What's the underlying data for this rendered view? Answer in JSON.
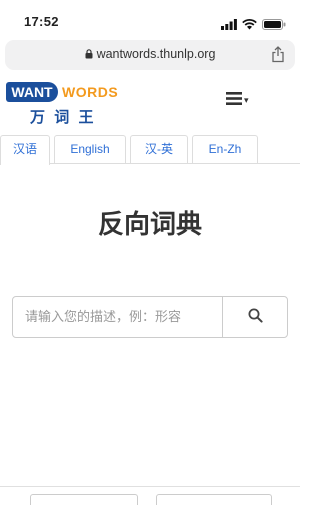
{
  "status_bar": {
    "time": "17:52",
    "signal_icon": "signal-bars-icon",
    "wifi_icon": "wifi-icon",
    "battery_icon": "battery-icon"
  },
  "browser": {
    "lock_icon": "lock-icon",
    "url": "wantwords.thunlp.org",
    "share_icon": "share-icon"
  },
  "header": {
    "logo": {
      "want": "WANT",
      "words": "WORDS",
      "chinese": "万 词 王"
    },
    "menu_icon": "hamburger-menu-icon",
    "menu_caret": "▾"
  },
  "tabs": [
    {
      "label": "汉语",
      "active": true
    },
    {
      "label": "English",
      "active": false
    },
    {
      "label": "汉-英",
      "active": false
    },
    {
      "label": "En-Zh",
      "active": false
    }
  ],
  "main": {
    "title": "反向词典",
    "search": {
      "placeholder": "请输入您的描述，例：形容",
      "value": "",
      "search_icon": "magnifier-icon"
    }
  },
  "colors": {
    "brand_blue": "#1b4f9c",
    "brand_orange": "#f39a1e",
    "tab_active": "#2f6fd6",
    "border": "#dddddd"
  }
}
